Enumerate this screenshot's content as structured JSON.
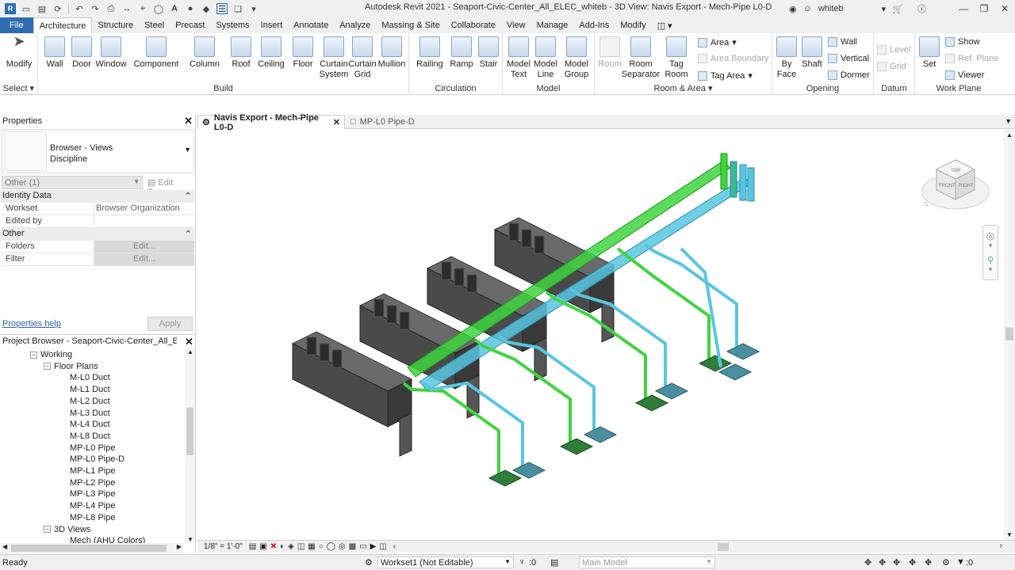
{
  "window": {
    "title": "Autodesk Revit 2021 - Seaport-Civic-Center_All_ELEC_whiteb - 3D View: Navis Export - Mech-Pipe L0-D",
    "user": "whiteb"
  },
  "ribbon_tabs": [
    "File",
    "Architecture",
    "Structure",
    "Steel",
    "Precast",
    "Systems",
    "Insert",
    "Annotate",
    "Analyze",
    "Massing & Site",
    "Collaborate",
    "View",
    "Manage",
    "Add-Ins",
    "Modify"
  ],
  "ribbon": {
    "select_label": "Select",
    "modify": "Modify",
    "build": {
      "label": "Build",
      "buttons": [
        "Wall",
        "Door",
        "Window",
        "Component",
        "Column",
        "Roof",
        "Ceiling",
        "Floor",
        "Curtain System",
        "Curtain Grid",
        "Mullion"
      ]
    },
    "circulation": {
      "label": "Circulation",
      "buttons": [
        "Railing",
        "Ramp",
        "Stair"
      ]
    },
    "model": {
      "label": "Model",
      "buttons": [
        "Model Text",
        "Model Line",
        "Model Group"
      ]
    },
    "room_area": {
      "label": "Room & Area",
      "buttons": [
        "Room",
        "Room Separator",
        "Tag Room"
      ],
      "small": [
        "Area",
        "Area Boundary",
        "Tag Area"
      ]
    },
    "opening": {
      "label": "Opening",
      "buttons": [
        "By Face",
        "Shaft"
      ],
      "small": [
        "Wall",
        "Vertical",
        "Dormer"
      ]
    },
    "datum": {
      "label": "Datum",
      "small": [
        "Level",
        "Grid"
      ]
    },
    "work_plane": {
      "label": "Work Plane",
      "buttons": [
        "Set"
      ],
      "small": [
        "Show",
        "Ref. Plane",
        "Viewer"
      ]
    }
  },
  "properties": {
    "title": "Properties",
    "type_line1": "Browser - Views",
    "type_line2": "Discipline",
    "filter": "Other (1)",
    "edit_type": "Edit Type",
    "groups": [
      {
        "name": "Identity Data",
        "rows": [
          {
            "k": "Workset",
            "v": "Browser Organization"
          },
          {
            "k": "Edited by",
            "v": ""
          }
        ]
      },
      {
        "name": "Other",
        "rows": [
          {
            "k": "Folders",
            "v": "Edit..."
          },
          {
            "k": "Filter",
            "v": "Edit..."
          }
        ]
      }
    ],
    "help": "Properties help",
    "apply": "Apply"
  },
  "project_browser": {
    "title": "Project Browser - Seaport-Civic-Center_All_ELEC_whiteb",
    "nodes": [
      {
        "label": "Working",
        "level": 0,
        "toggle": "−"
      },
      {
        "label": "Floor Plans",
        "level": 1,
        "toggle": "−"
      },
      {
        "label": "M-L0 Duct",
        "level": 2
      },
      {
        "label": "M-L1 Duct",
        "level": 2
      },
      {
        "label": "M-L2 Duct",
        "level": 2
      },
      {
        "label": "M-L3 Duct",
        "level": 2
      },
      {
        "label": "M-L4 Duct",
        "level": 2
      },
      {
        "label": "M-L8 Duct",
        "level": 2
      },
      {
        "label": "MP-L0 Pipe",
        "level": 2
      },
      {
        "label": "MP-L0 Pipe-D",
        "level": 2
      },
      {
        "label": "MP-L1 Pipe",
        "level": 2
      },
      {
        "label": "MP-L2 Pipe",
        "level": 2
      },
      {
        "label": "MP-L3 Pipe",
        "level": 2
      },
      {
        "label": "MP-L4 Pipe",
        "level": 2
      },
      {
        "label": "MP-L8 Pipe",
        "level": 2
      },
      {
        "label": "3D Views",
        "level": 1,
        "toggle": "−"
      },
      {
        "label": "Mech (AHU Colors)",
        "level": 2
      }
    ]
  },
  "view_tabs": [
    {
      "label": "Navis Export - Mech-Pipe L0-D",
      "active": true
    },
    {
      "label": "MP-L0 Pipe-D",
      "active": false
    }
  ],
  "viewcube": {
    "top": "TOP",
    "front": "FRONT",
    "right": "RIGHT"
  },
  "view_bar": {
    "scale": "1/8\" = 1'-0\""
  },
  "status": {
    "text": "Ready",
    "workset": "Workset1 (Not Editable)",
    "zero": ":0",
    "model": "Main Model",
    "filter_count": ":0"
  },
  "colors": {
    "green": "#3fd43f",
    "cyan": "#59c6e0",
    "accent": "#2f6db3",
    "chiller": "#4a4a4a"
  }
}
